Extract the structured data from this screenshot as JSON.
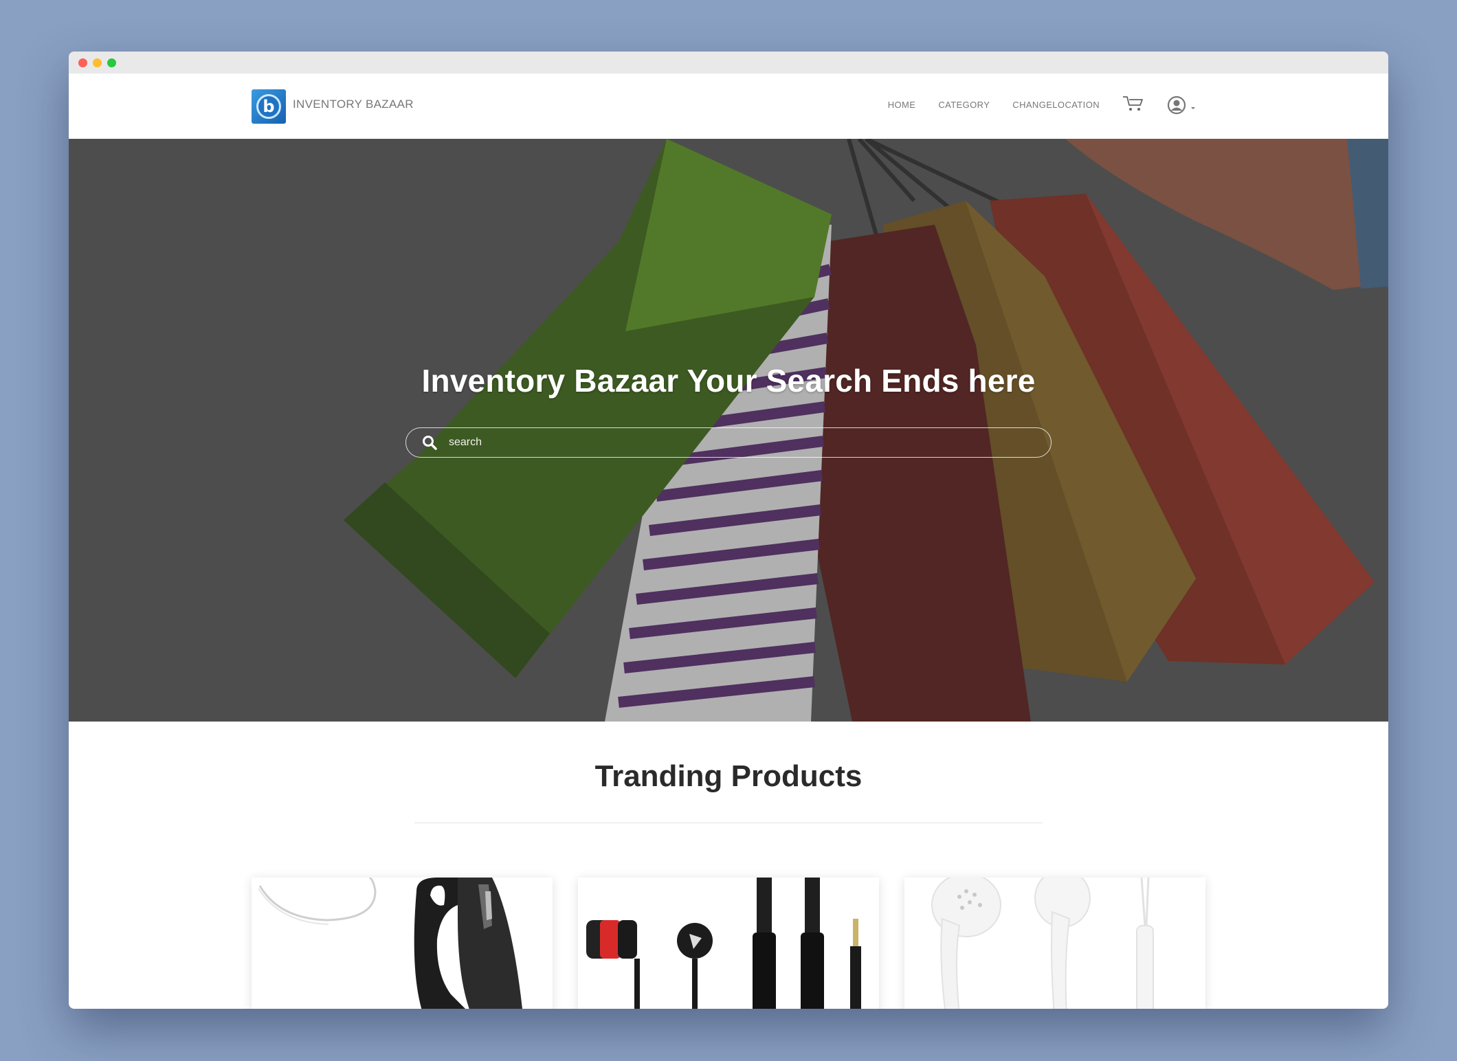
{
  "browser": {
    "controls": [
      "close",
      "minimize",
      "maximize"
    ]
  },
  "header": {
    "brand_name": "INVENTORY BAZAAR",
    "logo_letter": "b",
    "nav": [
      {
        "label": "HOME"
      },
      {
        "label": "CATEGORY"
      },
      {
        "label": "CHANGELOCATION"
      }
    ],
    "cart_icon": "cart-icon",
    "user_icon": "user-account-icon"
  },
  "hero": {
    "title": "Inventory Bazaar Your Search Ends here",
    "search": {
      "placeholder": "search",
      "value": ""
    },
    "background": "shopping-bags-image"
  },
  "trending": {
    "title": "Tranding Products",
    "products": [
      {
        "image": "bluetooth-headset-image"
      },
      {
        "image": "black-red-earphones-image"
      },
      {
        "image": "white-earphones-image"
      }
    ]
  },
  "colors": {
    "page_bg": "#8aa0c2",
    "logo_blue": "#1e73c4",
    "text_dark": "#2a2a2a",
    "nav_text": "#777777"
  }
}
